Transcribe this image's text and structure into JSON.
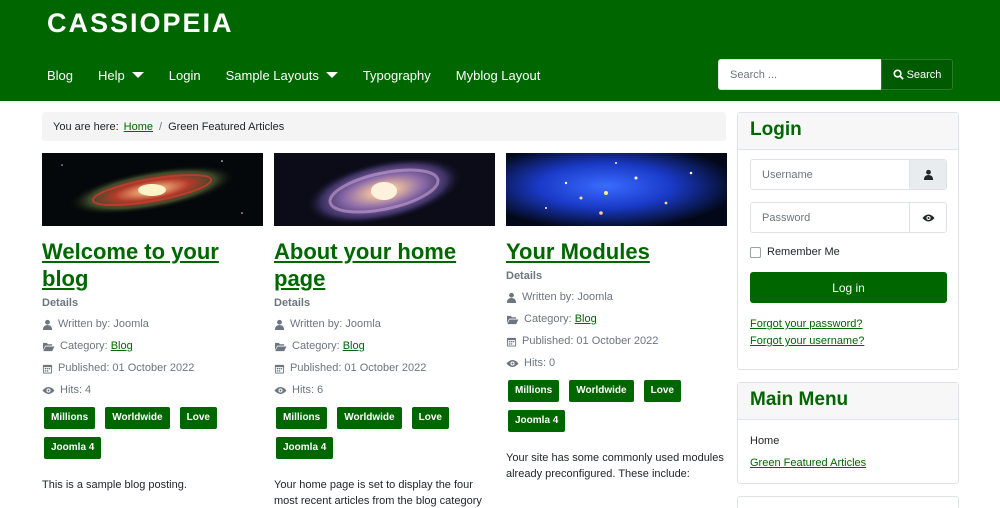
{
  "header": {
    "brand": "CASSIOPEIA",
    "nav": [
      {
        "label": "Blog"
      },
      {
        "label": "Help"
      },
      {
        "label": "Login"
      },
      {
        "label": "Sample Layouts"
      },
      {
        "label": "Typography"
      },
      {
        "label": "Myblog Layout"
      }
    ],
    "search_placeholder": "Search ...",
    "search_button": "Search"
  },
  "breadcrumb": {
    "prefix": "You are here:",
    "home": "Home",
    "separator": "/",
    "current": "Green Featured Articles"
  },
  "articles": [
    {
      "title": "Welcome to your blog",
      "details": "Details",
      "author": "Written by: Joomla",
      "category_prefix": "Category:",
      "category": "Blog",
      "published": "Published: 01 October 2022",
      "hits": "Hits: 4",
      "tags": [
        "Millions",
        "Worldwide",
        "Love",
        "Joomla 4"
      ],
      "intro": "This is a sample blog posting."
    },
    {
      "title": "About your home page",
      "details": "Details",
      "author": "Written by: Joomla",
      "category_prefix": "Category:",
      "category": "Blog",
      "published": "Published: 01 October 2022",
      "hits": "Hits: 6",
      "tags": [
        "Millions",
        "Worldwide",
        "Love",
        "Joomla 4"
      ],
      "intro": "Your home page is set to display the four most recent articles from the blog category"
    },
    {
      "title": "Your Modules",
      "details": "Details",
      "author": "Written by: Joomla",
      "category_prefix": "Category:",
      "category": "Blog",
      "published": "Published: 01 October 2022",
      "hits": "Hits: 0",
      "tags": [
        "Millions",
        "Worldwide",
        "Love",
        "Joomla 4"
      ],
      "intro": "Your site has some commonly used modules already preconfigured. These include:"
    }
  ],
  "login": {
    "title": "Login",
    "username_placeholder": "Username",
    "password_placeholder": "Password",
    "remember": "Remember Me",
    "button": "Log in",
    "forgot_password": "Forgot your password?",
    "forgot_username": "Forgot your username?"
  },
  "main_menu": {
    "title": "Main Menu",
    "items": [
      {
        "label": "Home"
      },
      {
        "label": "Green Featured Articles"
      }
    ]
  },
  "colors": {
    "brand": "#006600",
    "muted": "#6d757e",
    "card_border": "#dfe3e7"
  }
}
